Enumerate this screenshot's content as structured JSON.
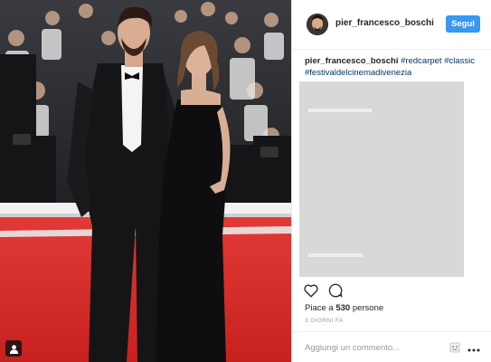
{
  "post": {
    "username": "pier_francesco_boschi",
    "follow_label": "Segui",
    "caption": {
      "username": "pier_francesco_boschi",
      "hashtags": [
        "#redcarpet",
        "#classic",
        "#festivaldelcinemadivenezia"
      ]
    },
    "likes_prefix": "Piace a",
    "likes_count": "530",
    "likes_suffix": "persone",
    "timestamp": "3 GIORNI FA",
    "comment_placeholder": "Aggiungi un commento..."
  },
  "icons": {
    "like": "heart-icon",
    "comment": "comment-bubble-icon",
    "tag": "person-tag-icon",
    "more": "more-options-icon",
    "sticker": "sticker-icon"
  },
  "colors": {
    "follow_button": "#3897f0",
    "hashtag": "#003569",
    "red_carpet": "#d62b2b"
  }
}
